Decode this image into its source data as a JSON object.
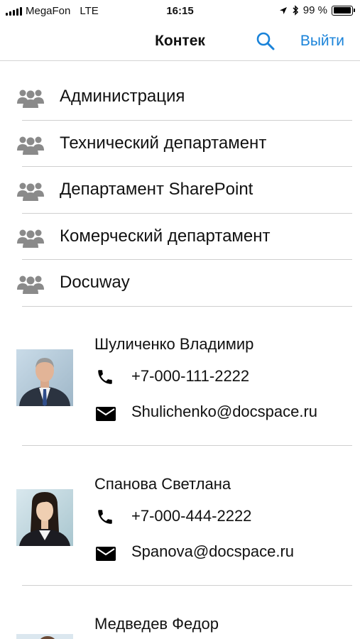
{
  "status_bar": {
    "carrier": "MegaFon",
    "network": "LTE",
    "time": "16:15",
    "battery": "99 %",
    "battery_level": 0.99
  },
  "nav": {
    "title": "Контек",
    "logout_label": "Выйти",
    "accent_color": "#1a83d9"
  },
  "departments": [
    {
      "label": "Администрация",
      "icon": "group-icon"
    },
    {
      "label": "Технический департамент",
      "icon": "group-icon"
    },
    {
      "label": "Департамент SharePoint",
      "icon": "group-icon"
    },
    {
      "label": "Комерческий департамент",
      "icon": "group-icon"
    },
    {
      "label": "Docuway",
      "icon": "group-icon"
    }
  ],
  "contacts": [
    {
      "name": "Шуличенко Владимир",
      "phone": "+7-000-111-2222",
      "email": "Shulichenko@docspace.ru"
    },
    {
      "name": "Спанова Светлана",
      "phone": "+7-000-444-2222",
      "email": "Spanova@docspace.ru"
    },
    {
      "name": "Медведев Федор"
    }
  ]
}
